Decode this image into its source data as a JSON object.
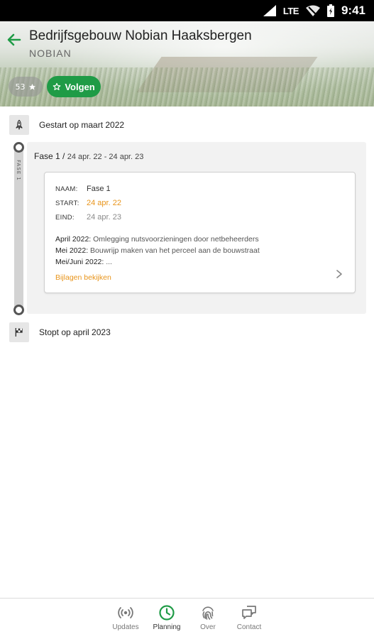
{
  "status_bar": {
    "network": "LTE",
    "time": "9:41"
  },
  "header": {
    "title": "Bedrijfsgebouw Nobian Haaksbergen",
    "subtitle": "NOBIAN",
    "rating_count": "53",
    "follow_label": "Volgen"
  },
  "timeline": {
    "start_label": "Gestart op maart 2022",
    "end_label": "Stopt op april 2023",
    "phase_rail_label": "FASE 1",
    "phase": {
      "name_heading": "Fase 1 /",
      "date_range": "24 apr. 22 - 24 apr. 23",
      "card": {
        "name_key": "NAAM:",
        "name_value": "Fase 1",
        "start_key": "START:",
        "start_value": "24 apr. 22",
        "end_key": "EIND:",
        "end_value": "24 apr. 23",
        "lines": [
          {
            "label": "April 2022:",
            "text": " Omlegging nutsvoorzieningen door netbeheerders"
          },
          {
            "label": "Mei 2022:",
            "text": " Bouwrijp maken van het perceel aan de bouwstraat"
          },
          {
            "label": "Mei/Juni 2022:",
            "text": " ..."
          }
        ],
        "attachments_link": "Bijlagen bekijken"
      }
    }
  },
  "bottom_nav": {
    "items": [
      {
        "label": "Updates",
        "icon": "broadcast-icon"
      },
      {
        "label": "Planning",
        "icon": "clock-icon"
      },
      {
        "label": "Over",
        "icon": "fingerprint-icon"
      },
      {
        "label": "Contact",
        "icon": "chat-icon"
      }
    ],
    "active": "Planning",
    "accent": "#1f9b46"
  },
  "colors": {
    "accent_green": "#1f9b46",
    "accent_orange": "#e8941a"
  }
}
